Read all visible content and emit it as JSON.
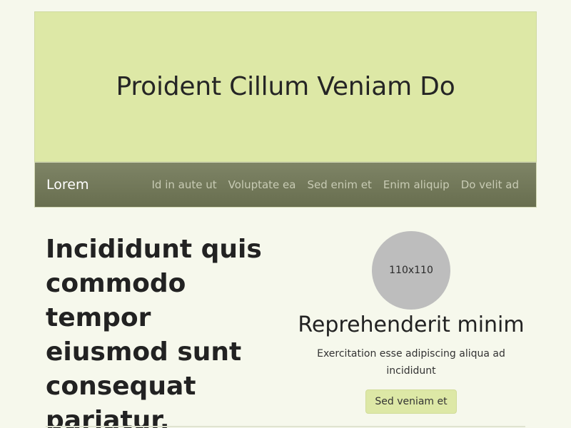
{
  "hero": {
    "title": "Proident Cillum Veniam Do"
  },
  "navbar": {
    "brand": "Lorem",
    "links": [
      "Id in aute ut",
      "Voluptate ea",
      "Sed enim et",
      "Enim aliquip",
      "Do velit ad"
    ]
  },
  "main": {
    "headline": "Incididunt quis commodo tempor eiusmod sunt consequat pariatur.",
    "card": {
      "image_label": "110x110",
      "title": "Reprehenderit minim",
      "description": "Exercitation esse adipiscing aliqua ad incididunt",
      "button_label": "Sed veniam et"
    }
  },
  "colors": {
    "page_bg": "#f6f8ec",
    "hero_bg": "#dde8a6",
    "navbar_bg": "#6f7556",
    "button_bg": "#dde8a6",
    "avatar_bg": "#bdbdbd"
  }
}
